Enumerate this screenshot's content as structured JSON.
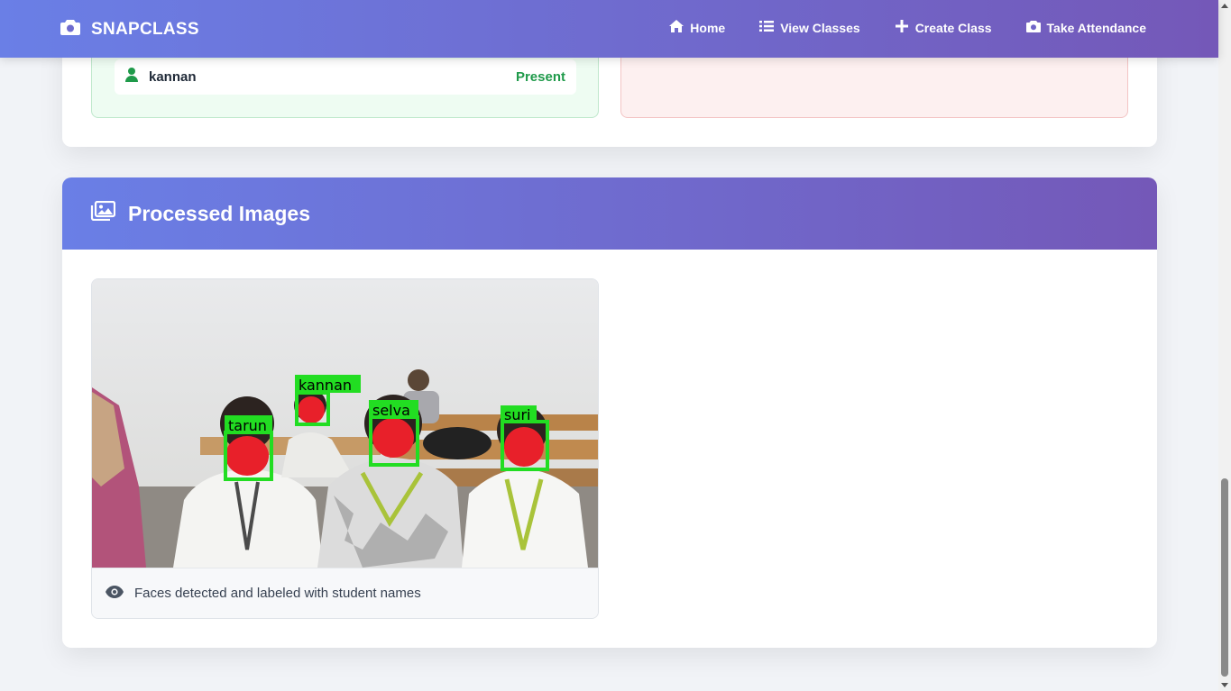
{
  "navbar": {
    "brand": "SNAPCLASS",
    "links": [
      {
        "label": "Home",
        "icon": "home-icon"
      },
      {
        "label": "View Classes",
        "icon": "list-icon"
      },
      {
        "label": "Create Class",
        "icon": "plus-icon"
      },
      {
        "label": "Take Attendance",
        "icon": "camera-icon"
      }
    ]
  },
  "attendance": {
    "present": [
      {
        "name": "kannan",
        "status": "Present"
      }
    ]
  },
  "processed_images": {
    "title": "Processed Images",
    "caption": "Faces detected and labeled with student names",
    "labels": [
      "tarun",
      "kannan",
      "selva",
      "suri"
    ]
  },
  "colors": {
    "accent_start": "#6a7fe6",
    "accent_end": "#7458b8",
    "present": "#1f9a4a",
    "face_box": "#22dd22",
    "face_blur": "#e8202a"
  }
}
